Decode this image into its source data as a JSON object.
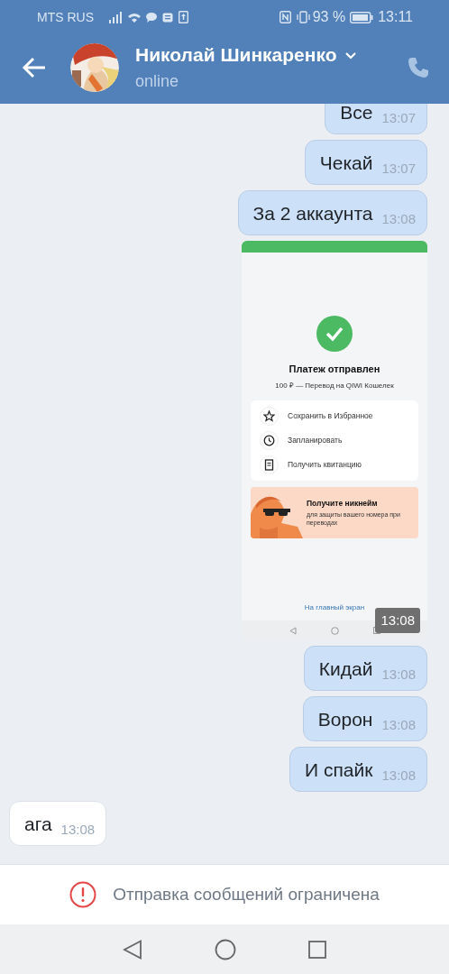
{
  "status_bar": {
    "carrier": "MTS RUS",
    "battery": "93 %",
    "time": "13:11"
  },
  "header": {
    "name": "Николай Шинкаренко",
    "presence": "online"
  },
  "messages": [
    {
      "kind": "text",
      "outgoing": true,
      "text": "Все",
      "time": "13:07"
    },
    {
      "kind": "text",
      "outgoing": true,
      "text": "Чекай",
      "time": "13:07"
    },
    {
      "kind": "text",
      "outgoing": true,
      "text": "За 2 аккаунта",
      "time": "13:08"
    },
    {
      "time": "13:08",
      "screenshot": {
        "title": "Платеж отправлен",
        "subtitle": "100 ₽ — Перевод на QIWI Кошелек",
        "actions": [
          {
            "kind": "favorite",
            "label": "Сохранить в Избранное"
          },
          {
            "kind": "schedule",
            "label": "Запланировать"
          },
          {
            "kind": "receipt",
            "label": "Получить квитанцию"
          }
        ],
        "promo": {
          "title": "Получите никнейм",
          "text": "для защиты вашего номера при переводах"
        },
        "link": "На главный экран"
      }
    },
    {
      "kind": "text",
      "outgoing": true,
      "text": "Кидай",
      "time": "13:08"
    },
    {
      "kind": "text",
      "outgoing": true,
      "text": "Ворон",
      "time": "13:08"
    },
    {
      "kind": "text",
      "outgoing": true,
      "text": "И спайк",
      "time": "13:08"
    },
    {
      "kind": "text",
      "outgoing": false,
      "text": "ага",
      "time": "13:08"
    }
  ],
  "notice": "Отправка сообщений ограничена"
}
